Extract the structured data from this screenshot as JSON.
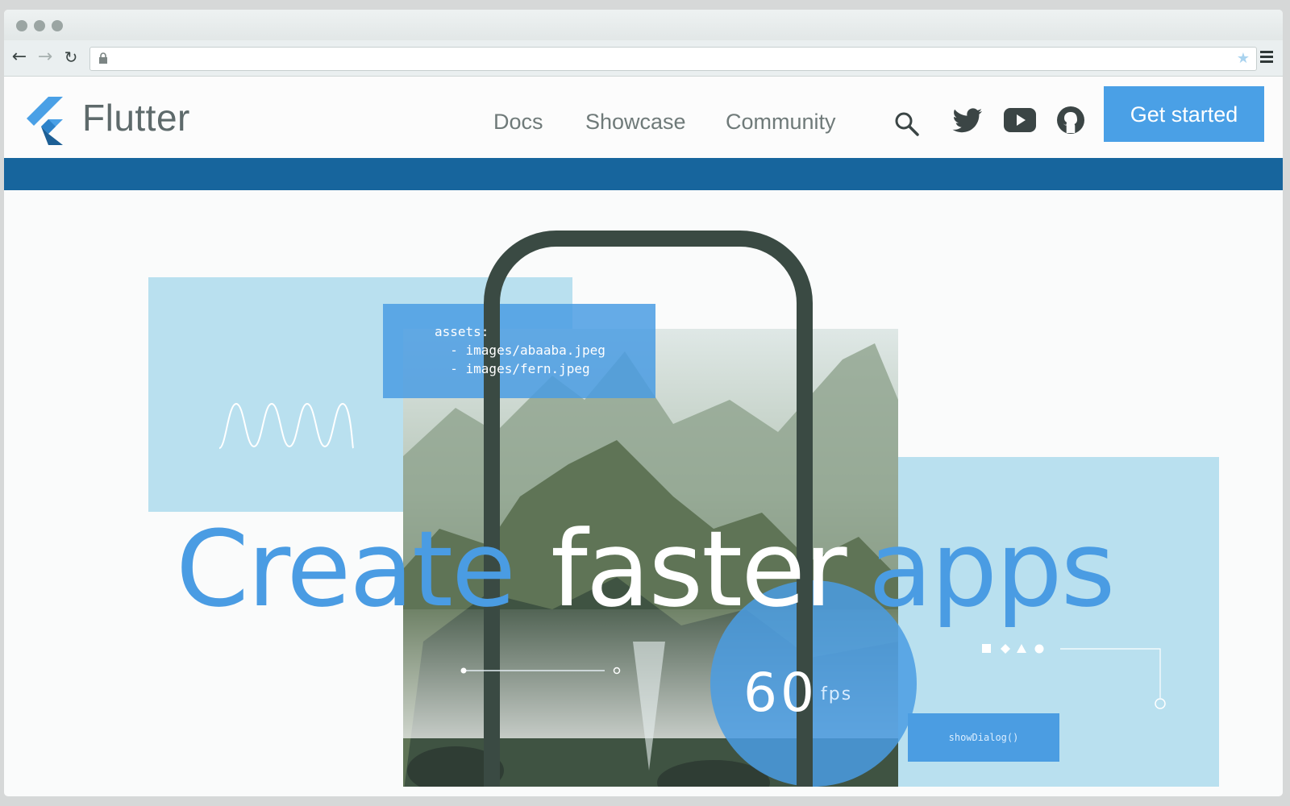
{
  "browser": {
    "address": "",
    "icons": [
      "back-arrow-icon",
      "forward-arrow-icon",
      "reload-icon",
      "lock-icon",
      "bookmark-star-icon",
      "menu-icon"
    ]
  },
  "site": {
    "brand": "Flutter",
    "nav": {
      "docs": "Docs",
      "showcase": "Showcase",
      "community": "Community"
    },
    "icons": [
      "search-icon",
      "twitter-icon",
      "youtube-icon",
      "github-icon"
    ],
    "cta": "Get started"
  },
  "hero": {
    "headline": {
      "word1": "Create",
      "word2": "faster",
      "word3": "apps"
    },
    "code_lines": {
      "line1": "assets:",
      "line2": "  - images/abaaba.jpeg",
      "line3": "  - images/fern.jpeg"
    },
    "fps_value": "60",
    "fps_unit": "fps",
    "dialog_code": "showDialog()"
  },
  "colors": {
    "accent_blue": "#4aa0e6",
    "nav_bar_blue": "#17659d",
    "light_panel_blue": "#b9e0ef",
    "phone_frame": "#3a4a43",
    "brand_text": "#5e6a6b"
  }
}
